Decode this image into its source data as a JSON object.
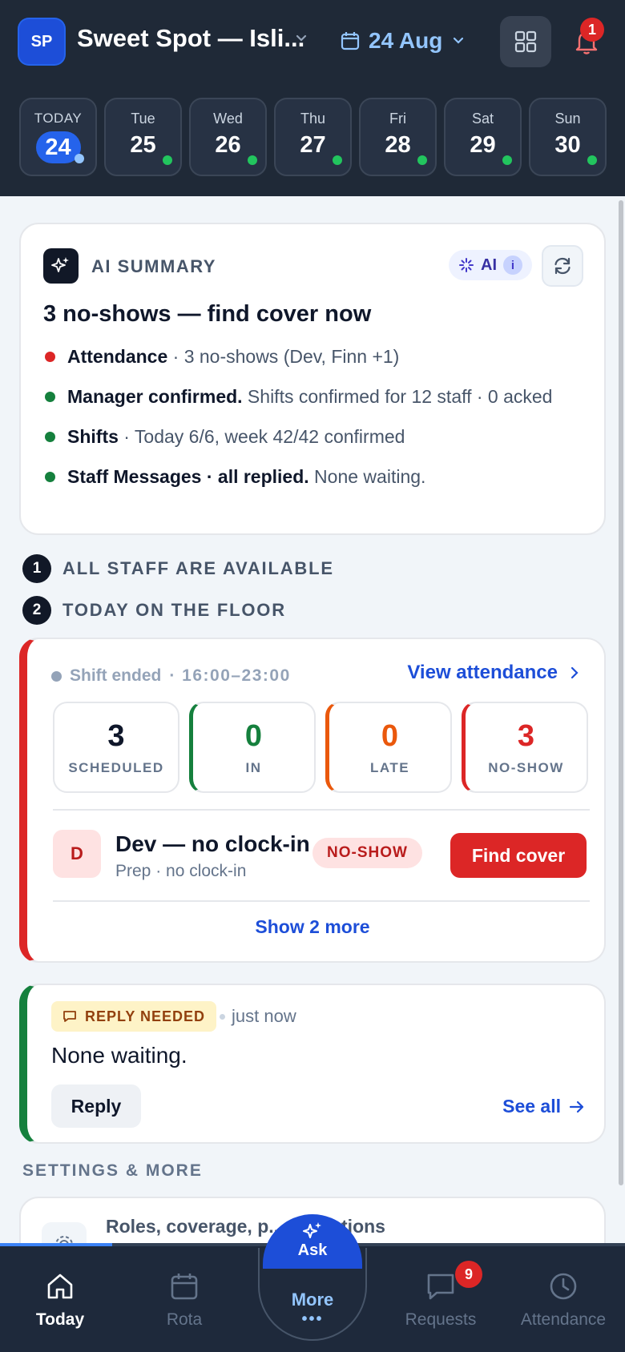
{
  "header": {
    "avatar_initials": "SP",
    "venue_name": "Sweet Spot — Isli...",
    "date_label": "24 Aug",
    "notification_count": "1"
  },
  "days": [
    {
      "name": "TODAY",
      "date": "24",
      "today": true
    },
    {
      "name": "Tue",
      "date": "25"
    },
    {
      "name": "Wed",
      "date": "26"
    },
    {
      "name": "Thu",
      "date": "27"
    },
    {
      "name": "Fri",
      "date": "28"
    },
    {
      "name": "Sat",
      "date": "29"
    },
    {
      "name": "Sun",
      "date": "30"
    }
  ],
  "ai_summary": {
    "label": "AI SUMMARY",
    "pill_label": "AI",
    "info": "i",
    "headline": "3 no-shows — find cover now",
    "bullets": [
      {
        "bold": "Attendance",
        "text": " · 3 no-shows (Dev, Finn +1)",
        "color": "#dc2626"
      },
      {
        "bold": "Manager confirmed.",
        "text": " Shifts confirmed for 12 staff · 0 acked",
        "color": "#15803d"
      },
      {
        "bold": "Shifts",
        "text": " · Today 6/6, week 42/42 confirmed",
        "color": "#15803d"
      },
      {
        "bold": "Staff Messages · all replied.",
        "text": " None waiting.",
        "color": "#15803d"
      }
    ]
  },
  "sections": {
    "one_num": "1",
    "one_title": "ALL STAFF ARE AVAILABLE",
    "two_num": "2",
    "two_title": "TODAY ON THE FLOOR"
  },
  "floor": {
    "shift_status": "Shift ended",
    "shift_time": "· 16:00–23:00",
    "view_attendance": "View attendance",
    "stats": [
      {
        "value": "3",
        "label": "SCHEDULED",
        "color": "#0f172a"
      },
      {
        "value": "0",
        "label": "IN",
        "color": "#15803d"
      },
      {
        "value": "0",
        "label": "LATE",
        "color": "#ea580c"
      },
      {
        "value": "3",
        "label": "NO-SHOW",
        "color": "#dc2626"
      }
    ],
    "staff_initial": "D",
    "staff_name": "Dev — no clock-in",
    "staff_sub": "Prep · no clock-in",
    "staff_badge": "NO-SHOW",
    "find_cover": "Find cover",
    "show_more": "Show 2 more"
  },
  "reply": {
    "badge": "REPLY NEEDED",
    "time": "just now",
    "message": "None waiting.",
    "reply_button": "Reply",
    "see_all": "See all"
  },
  "settings": {
    "title": "SETTINGS & MORE",
    "item_text": "Roles, coverage, p... ck stations"
  },
  "progress_fraction": 0.18,
  "nav": {
    "today": "Today",
    "rota": "Rota",
    "ask": "Ask",
    "more": "More",
    "requests": "Requests",
    "requests_badge": "9",
    "attendance": "Attendance"
  }
}
